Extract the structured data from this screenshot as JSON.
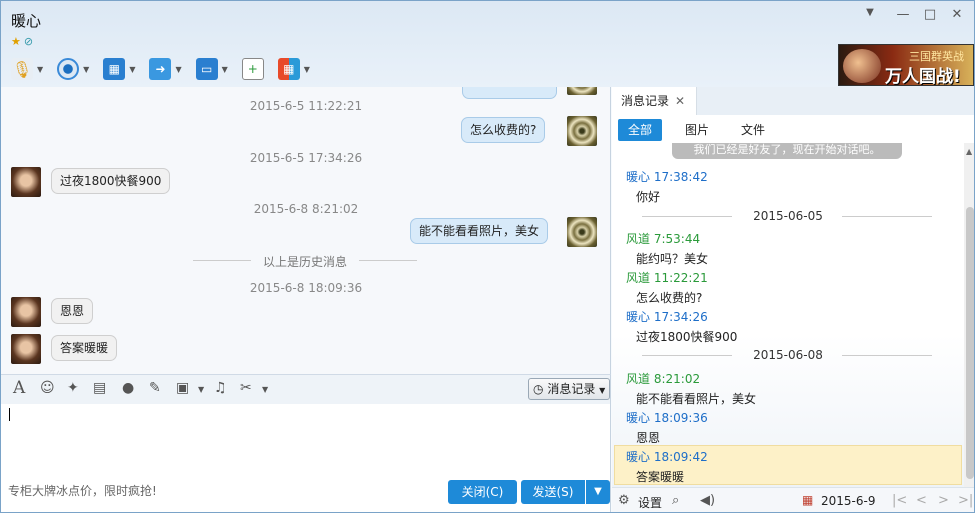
{
  "window": {
    "title": "暖心",
    "controls": {
      "collapse": "▼",
      "minimize": "—",
      "maximize": "□",
      "close": "✕"
    }
  },
  "toolbar": {
    "icons": [
      "microphone-icon",
      "webcam-icon",
      "screen-share-icon",
      "file-transfer-icon",
      "remote-assist-icon",
      "create-discussion-icon",
      "apps-icon"
    ]
  },
  "ad": {
    "line1": "三国群英战",
    "line2": "万人国战!"
  },
  "chat": {
    "timestamps": [
      "2015-6-5 11:22:21",
      "2015-6-5 17:34:26",
      "2015-6-8 8:21:02",
      "2015-6-8 18:09:36"
    ],
    "history_divider": "以上是历史消息",
    "messages": [
      {
        "side": "right",
        "text": "怎么收费的?"
      },
      {
        "side": "left",
        "text": "过夜1800快餐900"
      },
      {
        "side": "right",
        "text": "能不能看看照片，美女"
      },
      {
        "side": "left",
        "text": "恩恩"
      },
      {
        "side": "left",
        "text": "答案暖暖"
      }
    ]
  },
  "input": {
    "history_button": "消息记录",
    "promo_text": "专柜大牌冰点价，限时疯抢!",
    "close_button": "关闭(C)",
    "send_button": "发送(S)"
  },
  "history": {
    "tab_label": "消息记录",
    "filters": [
      "全部",
      "图片",
      "文件"
    ],
    "active_filter": "全部",
    "tip_text": "我们已经是好友了，现在开始对话吧。",
    "entries": [
      {
        "type": "msg",
        "sender": "暖心",
        "time": "17:38:42",
        "color": "blue",
        "text": "你好"
      },
      {
        "type": "date",
        "text": "2015-06-05"
      },
      {
        "type": "msg",
        "sender": "风道",
        "time": "7:53:44",
        "color": "green",
        "text": "能约吗？美女"
      },
      {
        "type": "msg",
        "sender": "风道",
        "time": "11:22:21",
        "color": "green",
        "text": "怎么收费的?"
      },
      {
        "type": "msg",
        "sender": "暖心",
        "time": "17:34:26",
        "color": "blue",
        "text": "过夜1800快餐900"
      },
      {
        "type": "date",
        "text": "2015-06-08"
      },
      {
        "type": "msg",
        "sender": "风道",
        "time": "8:21:02",
        "color": "green",
        "text": "能不能看看照片，美女"
      },
      {
        "type": "msg",
        "sender": "暖心",
        "time": "18:09:36",
        "color": "blue",
        "text": "恩恩"
      },
      {
        "type": "msg",
        "sender": "暖心",
        "time": "18:09:42",
        "color": "blue",
        "text": "答案暖暖",
        "highlighted": true
      }
    ],
    "footer": {
      "settings_label": "设置",
      "date": "2015-6-9"
    }
  },
  "colors": {
    "accent": "#1e8ad8",
    "green_sender": "#2a9a3a",
    "blue_sender": "#1e6ec8",
    "highlight": "#fdf1c8"
  }
}
